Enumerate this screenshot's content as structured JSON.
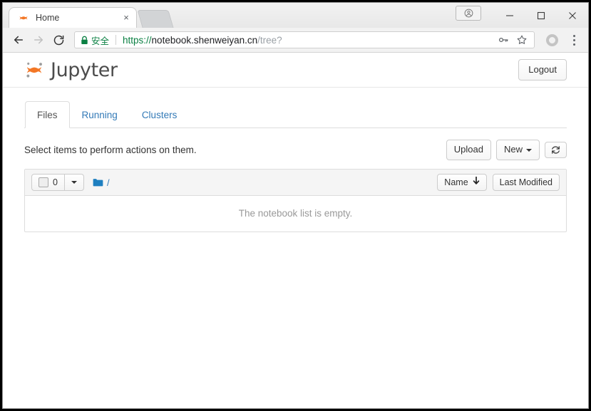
{
  "browser": {
    "tab": {
      "title": "Home",
      "favicon": "jupyter-favicon",
      "close_label": "×"
    },
    "newtab_label": "",
    "window_controls": {
      "profile_label": "profile-badge",
      "minimize": "—",
      "maximize": "□",
      "close": "✕"
    },
    "nav": {
      "back": "←",
      "forward": "→",
      "reload": "⟳"
    },
    "omnibox": {
      "security_label": "安全",
      "security_icon": "lock-icon",
      "url_scheme": "https://",
      "url_host": "notebook.shenweiyan.cn",
      "url_path": "/tree?",
      "key_icon": "key-icon",
      "star_icon": "star-icon"
    },
    "profile_icon": "account-circle-icon",
    "menu_icon": "three-dot-menu-icon"
  },
  "jupyter": {
    "brand": "Jupyter",
    "logo_icon": "jupyter-logo",
    "logout_label": "Logout",
    "tabs": [
      {
        "label": "Files",
        "active": true
      },
      {
        "label": "Running",
        "active": false
      },
      {
        "label": "Clusters",
        "active": false
      }
    ],
    "toolbar": {
      "hint": "Select items to perform actions on them.",
      "upload_label": "Upload",
      "new_label": "New",
      "refresh_icon": "refresh-icon"
    },
    "filelist": {
      "select_count": "0",
      "select_caret_icon": "chevron-down-icon",
      "breadcrumb_folder_icon": "folder-icon",
      "breadcrumb_path": "/",
      "sort_name_label": "Name",
      "sort_name_arrow": "↓",
      "sort_modified_label": "Last Modified",
      "empty_message": "The notebook list is empty."
    }
  },
  "colors": {
    "jupyter_orange": "#f37726",
    "jupyter_gray": "#9e9e9e",
    "link_blue": "#337ab7",
    "folder_blue": "#1e7fc0",
    "secure_green": "#0b8043",
    "panel_header": "#f5f5f5",
    "border": "#dddddd"
  }
}
